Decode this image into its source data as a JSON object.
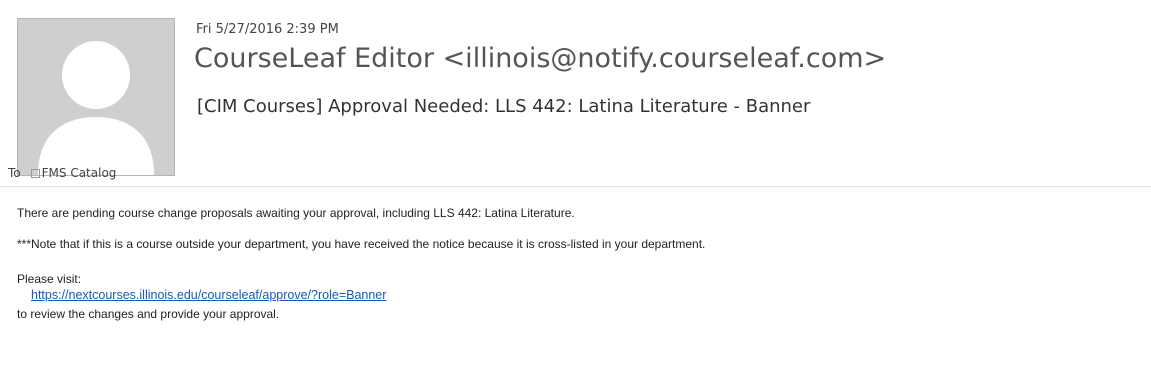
{
  "email": {
    "date": "Fri 5/27/2016 2:39 PM",
    "sender": "CourseLeaf Editor <illinois@notify.courseleaf.com>",
    "subject": "[CIM Courses] Approval Needed: LLS 442: Latina Literature - Banner",
    "to_label": "To",
    "recipient": "FMS Catalog",
    "body": {
      "line1": "There are pending course change proposals awaiting your approval, including LLS 442: Latina Literature.",
      "line2": "***Note that if this is a course outside your department, you have received the  notice because it is cross-listed in your department.",
      "line3": "Please visit:",
      "link": "https://nextcourses.illinois.edu/courseleaf/approve/?role=Banner",
      "line4": "to review the changes and provide your approval."
    }
  },
  "colors": {
    "avatar_bg": "#cfcfcf",
    "avatar_fg": "#ffffff",
    "link": "#1b58b8"
  },
  "icons": {
    "avatar": "person-silhouette-icon",
    "recipient": "checkbox-icon"
  }
}
